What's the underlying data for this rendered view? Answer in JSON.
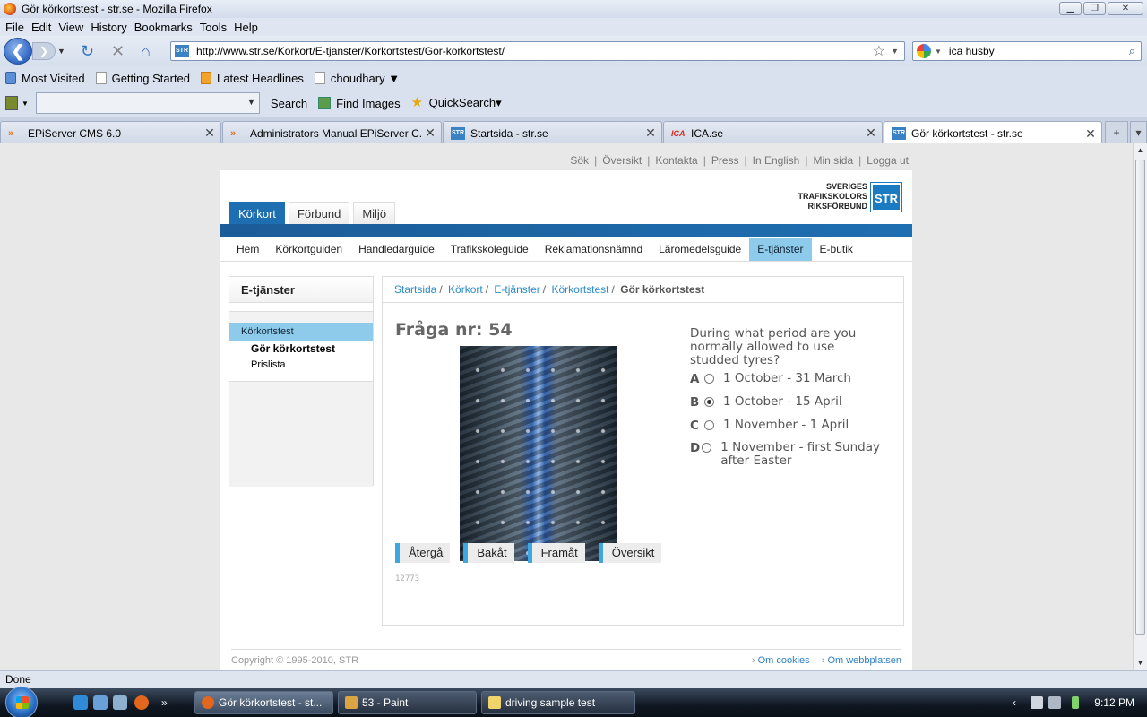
{
  "window": {
    "title": "Gör körkortstest - str.se - Mozilla Firefox"
  },
  "menu": [
    "File",
    "Edit",
    "View",
    "History",
    "Bookmarks",
    "Tools",
    "Help"
  ],
  "url": "http://www.str.se/Korkort/E-tjanster/Korkortstest/Gor-korkortstest/",
  "search": {
    "value": "ica husby"
  },
  "bookmarks": [
    "Most Visited",
    "Getting Started",
    "Latest Headlines",
    "choudhary ▼"
  ],
  "toolbar": {
    "search_label": "Search",
    "find_images": "Find Images",
    "quicksearch": "QuickSearch▾"
  },
  "tabs": [
    {
      "label": "EPiServer CMS 6.0"
    },
    {
      "label": "Administrators Manual EPiServer C..."
    },
    {
      "label": "Startsida - str.se"
    },
    {
      "label": "ICA.se"
    },
    {
      "label": "Gör körkortstest - str.se"
    }
  ],
  "page": {
    "toplinks": [
      "Sök",
      "Översikt",
      "Kontakta",
      "Press",
      "In English",
      "Min sida",
      "Logga ut"
    ],
    "logo_lines": [
      "SVERIGES",
      "TRAFIKSKOLORS",
      "RIKSFÖRBUND"
    ],
    "logo_box": "STR",
    "main_tabs": [
      "Körkort",
      "Förbund",
      "Miljö"
    ],
    "subnav": [
      "Hem",
      "Körkortguiden",
      "Handledarguide",
      "Trafikskoleguide",
      "Reklamationsnämnd",
      "Läromedelsguide",
      "E-tjänster",
      "E-butik"
    ],
    "left": {
      "heading": "E-tjänster",
      "selected": "Körkortstest",
      "sub_active": "Gör körkortstest",
      "sub_item": "Prislista"
    },
    "breadcrumb": [
      "Startsida",
      "Körkort",
      "E-tjänster",
      "Körkortstest"
    ],
    "breadcrumb_current": "Gör körkortstest",
    "question_title": "Fråga nr: 54",
    "question_text": "During what period are you normally allowed to use studded tyres?",
    "answers": [
      {
        "letter": "A",
        "text": "1 October - 31 March",
        "checked": false
      },
      {
        "letter": "B",
        "text": "1 October - 15 April",
        "checked": true
      },
      {
        "letter": "C",
        "text": "1 November - 1 April",
        "checked": false
      },
      {
        "letter": "D",
        "text": "1 November - first Sunday after Easter",
        "checked": false
      }
    ],
    "buttons": [
      "Återgå",
      "Bakåt",
      "Framåt",
      "Översikt"
    ],
    "question_id": "12773",
    "copyright": "Copyright © 1995-2010, STR",
    "footer_links": [
      "Om cookies",
      "Om webbplatsen"
    ]
  },
  "status": "Done",
  "taskbar": {
    "items": [
      "Gör körkortstest - st...",
      "53 - Paint",
      "driving sample test"
    ],
    "clock": "9:12 PM"
  }
}
